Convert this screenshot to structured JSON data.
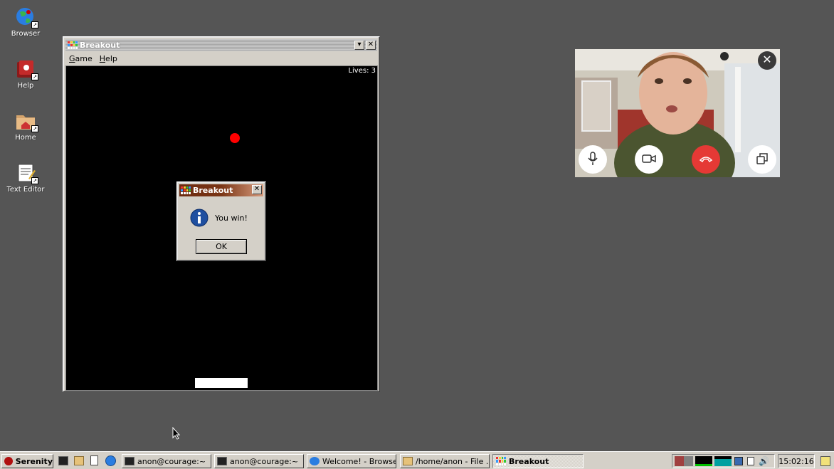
{
  "desktop": {
    "icons": [
      {
        "label": "Browser",
        "icon": "globe-icon"
      },
      {
        "label": "Help",
        "icon": "help-book-icon"
      },
      {
        "label": "Home",
        "icon": "home-folder-icon"
      },
      {
        "label": "Text Editor",
        "icon": "text-editor-icon"
      }
    ]
  },
  "breakout_window": {
    "title": "Breakout",
    "menu": [
      "Game",
      "Help"
    ],
    "lives": "Lives: 3",
    "colors": {
      "ball": "#ff0000",
      "paddle": "#ffffff",
      "background": "#000000"
    }
  },
  "dialog": {
    "title": "Breakout",
    "message": "You win!",
    "ok_label": "OK"
  },
  "video_call": {
    "controls": [
      "microphone-icon",
      "camera-icon",
      "hang-up-icon",
      "pop-out-icon"
    ],
    "colors": {
      "hang_up": "#e53935"
    }
  },
  "taskbar": {
    "start_label": "Serenity",
    "quick_launch": [
      "terminal-icon",
      "file-manager-icon",
      "text-editor-icon",
      "browser-icon"
    ],
    "tasks": [
      {
        "label": "anon@courage:~",
        "icon": "terminal-icon",
        "active": false
      },
      {
        "label": "anon@courage:~",
        "icon": "terminal-icon",
        "active": false
      },
      {
        "label": "Welcome! - Browser",
        "icon": "browser-icon",
        "active": false
      },
      {
        "label": "/home/anon - File ...",
        "icon": "folder-icon",
        "active": false
      },
      {
        "label": "Breakout",
        "icon": "breakout-icon",
        "active": true
      }
    ],
    "clock": "15:02:16"
  }
}
